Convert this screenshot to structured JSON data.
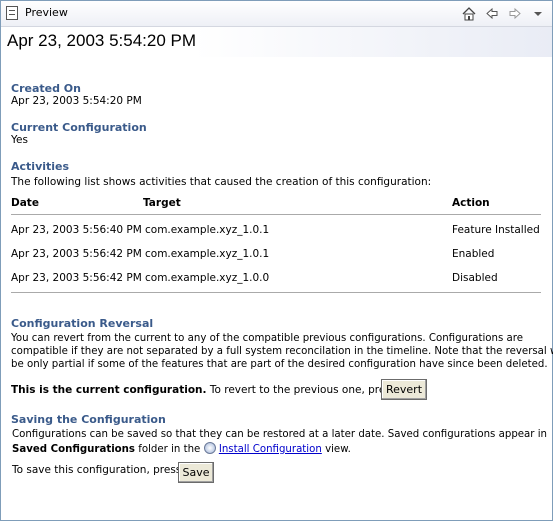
{
  "view": {
    "title": "Preview"
  },
  "toolbar": {
    "home": "home-icon",
    "back": "back-arrow-icon",
    "forward": "forward-arrow-icon"
  },
  "header": {
    "title": "Apr 23, 2003 5:54:20 PM"
  },
  "created": {
    "heading": "Created On",
    "value": "Apr 23, 2003 5:54:20 PM"
  },
  "current": {
    "heading": "Current Configuration",
    "value": "Yes"
  },
  "activities": {
    "heading": "Activities",
    "intro": "The following list shows activities that caused the creation of this configuration:",
    "columns": {
      "date": "Date",
      "target": "Target",
      "action": "Action"
    },
    "rows": [
      {
        "date": "Apr 23, 2003 5:56:40 PM",
        "target": "com.example.xyz_1.0.1",
        "action": "Feature Installed"
      },
      {
        "date": "Apr 23, 2003 5:56:42 PM",
        "target": "com.example.xyz_1.0.1",
        "action": "Enabled"
      },
      {
        "date": "Apr 23, 2003 5:56:42 PM",
        "target": "com.example.xyz_1.0.0",
        "action": "Disabled"
      }
    ]
  },
  "reversal": {
    "heading": "Configuration Reversal",
    "lines": [
      "You can revert from the current to any of the compatible previous configurations. Configurations are",
      "compatible if they are not separated by a full system reconcilation in the timeline. Note that the reversal will",
      "be only partial if some of the features that are part of the desired configuration have since been deleted."
    ],
    "bold_text": "This is the current configuration.",
    "prompt": "To revert to the previous one, press:",
    "button": "Revert"
  },
  "saving": {
    "heading": "Saving the Configuration",
    "line1": "Configurations can be saved so that they can be restored at a later date. Saved configurations appear in",
    "bold_folder": "Saved Configurations",
    "folder_text": "folder in the",
    "link": "Install Configuration",
    "view_text": "view.",
    "prompt": "To save this configuration, press:",
    "button": "Save"
  }
}
